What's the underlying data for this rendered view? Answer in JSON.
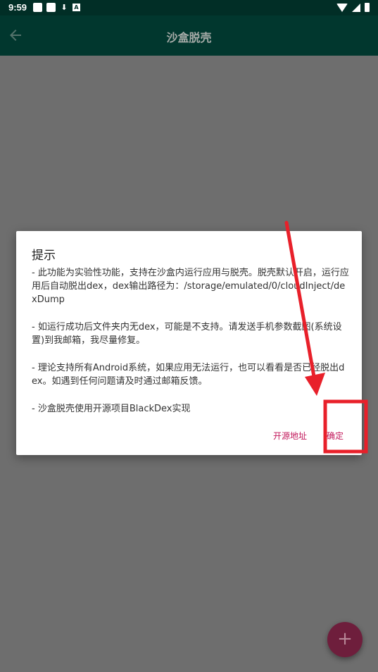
{
  "status_bar": {
    "time": "9:59",
    "left_icons": [
      "notification-square-icon",
      "notification-square-icon",
      "download-icon",
      "app-a-icon"
    ],
    "right_icons": [
      "wifi-icon",
      "signal-icon",
      "battery-icon"
    ]
  },
  "app_bar": {
    "title": "沙盒脱壳",
    "back_icon": "arrow-left-icon"
  },
  "dialog": {
    "title": "提示",
    "paragraphs": [
      "- 此功能为实验性功能，支持在沙盒内运行应用与脱壳。脱壳默认开启，运行应用后自动脱出dex，dex输出路径为：/storage/emulated/0/cloudInject/dexDump",
      "- 如运行成功后文件夹内无dex，可能是不支持。请发送手机参数截图(系统设置)到我邮箱，我尽量修复。",
      "- 理论支持所有Android系统，如果应用无法运行，也可以看看是否已经脱出dex。如遇到任何问题请及时通过邮箱反馈。",
      "- 沙盒脱壳使用开源项目BlackDex实现"
    ],
    "buttons": {
      "source": "开源地址",
      "confirm": "确定"
    }
  },
  "fab": {
    "icon": "plus-icon",
    "label": "+"
  },
  "colors": {
    "status_bar": "#012e26",
    "app_bar": "#01372e",
    "scrim": "#6e6e6e",
    "accent": "#c2185b",
    "annotation": "#e8202a"
  }
}
